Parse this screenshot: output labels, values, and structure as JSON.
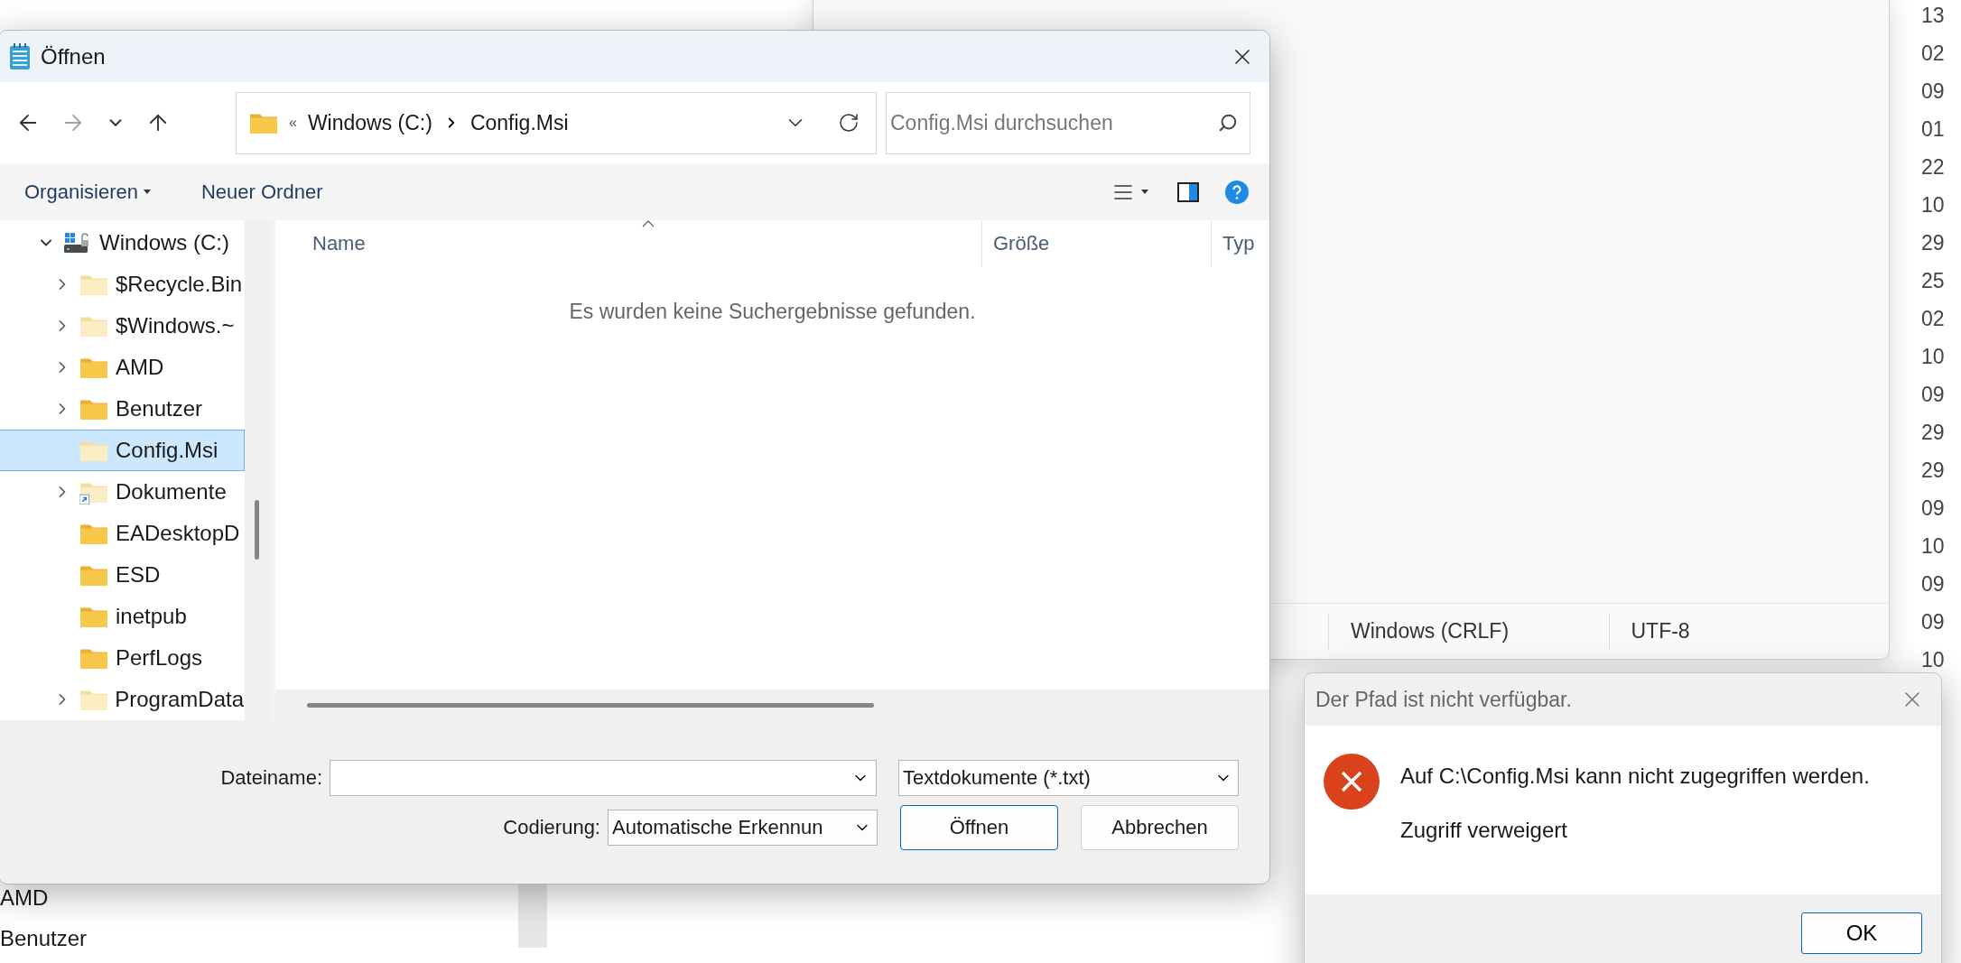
{
  "background_explorer": {
    "column_values": [
      "13",
      "02",
      "09",
      "01",
      "22",
      "10",
      "29",
      "25",
      "02",
      "10",
      "09",
      "29",
      "29",
      "09",
      "10",
      "09",
      "09",
      "10"
    ],
    "tree_items": [
      "AMD",
      "Benutzer"
    ]
  },
  "notepad": {
    "status": [
      "Windows (CRLF)",
      "UTF-8"
    ]
  },
  "dialog": {
    "title": "Öffnen",
    "nav": [
      {
        "kind": "back",
        "disabled": false
      },
      {
        "kind": "forward",
        "disabled": true
      },
      {
        "kind": "recent",
        "disabled": false
      },
      {
        "kind": "up",
        "disabled": false
      }
    ],
    "address": {
      "overflow": "«",
      "crumbs": [
        "Windows (C:)",
        "Config.Msi"
      ]
    },
    "search": {
      "placeholder": "Config.Msi durchsuchen"
    },
    "commands": [
      {
        "label": "Organisieren",
        "dropdown": true
      },
      {
        "label": "Neuer Ordner",
        "dropdown": false
      }
    ],
    "tree": [
      {
        "label": "Windows (C:)",
        "kind": "drive",
        "expanded": true,
        "selected": false,
        "children": [
          {
            "label": "$Recycle.Bin",
            "kind": "folder",
            "expandable": true,
            "selected": false,
            "hidden": true,
            "shortcut": false
          },
          {
            "label": "$Windows.~",
            "kind": "folder",
            "expandable": true,
            "selected": false,
            "hidden": true,
            "shortcut": false
          },
          {
            "label": "AMD",
            "kind": "folder",
            "expandable": true,
            "selected": false,
            "hidden": false,
            "shortcut": false
          },
          {
            "label": "Benutzer",
            "kind": "folder",
            "expandable": true,
            "selected": false,
            "hidden": false,
            "shortcut": false
          },
          {
            "label": "Config.Msi",
            "kind": "folder",
            "expandable": false,
            "selected": true,
            "hidden": true,
            "shortcut": false
          },
          {
            "label": "Dokumente",
            "kind": "folder",
            "expandable": true,
            "selected": false,
            "hidden": true,
            "shortcut": true
          },
          {
            "label": "EADesktopD",
            "kind": "folder",
            "expandable": false,
            "selected": false,
            "hidden": false,
            "shortcut": false
          },
          {
            "label": "ESD",
            "kind": "folder",
            "expandable": false,
            "selected": false,
            "hidden": false,
            "shortcut": false
          },
          {
            "label": "inetpub",
            "kind": "folder",
            "expandable": false,
            "selected": false,
            "hidden": false,
            "shortcut": false
          },
          {
            "label": "PerfLogs",
            "kind": "folder",
            "expandable": false,
            "selected": false,
            "hidden": false,
            "shortcut": false
          },
          {
            "label": "ProgramData",
            "kind": "folder",
            "expandable": true,
            "selected": false,
            "hidden": true,
            "shortcut": false
          }
        ]
      }
    ],
    "columns": [
      {
        "label": "Name",
        "sorted": true
      },
      {
        "label": "Größe",
        "sorted": false
      },
      {
        "label": "Typ",
        "sorted": false
      }
    ],
    "empty_message": "Es wurden keine Suchergebnisse gefunden.",
    "filename": {
      "label": "Dateiname:"
    },
    "filetype": {
      "value": "Textdokumente (*.txt)"
    },
    "encoding": {
      "label": "Codierung:",
      "value": "Automatische Erkennun"
    },
    "buttons": [
      {
        "label": "Öffnen",
        "default": true
      },
      {
        "label": "Abbrechen",
        "default": false
      }
    ]
  },
  "error": {
    "title": "Der Pfad ist nicht verfügbar.",
    "message": "Auf C:\\Config.Msi kann nicht zugegriffen werden.",
    "detail": "Zugriff verweigert",
    "buttons": [
      {
        "label": "OK",
        "default": true
      }
    ]
  }
}
